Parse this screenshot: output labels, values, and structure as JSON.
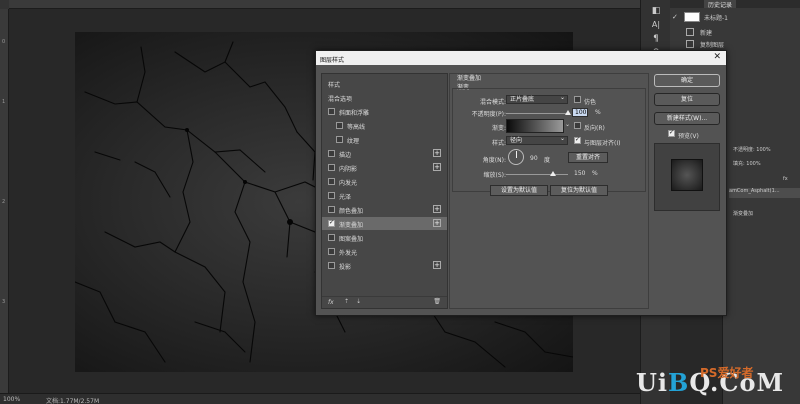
{
  "statusbar": {
    "zoom": "100%",
    "doc_info": "文档:1.77M/2.57M"
  },
  "rulers": {
    "left_ticks": [
      "0",
      "1",
      "2",
      "3"
    ]
  },
  "panels": {
    "top_tab": "历史记录",
    "history_items": [
      {
        "label": "未标题-1"
      },
      {
        "label": "新建"
      },
      {
        "label": "复制图层"
      }
    ],
    "layers_rows": [
      "不透明度: 100%",
      "填充: 100%",
      "fx",
      "amCom_Asphalt(1...",
      "渐变叠加"
    ]
  },
  "dialog": {
    "title": "图层样式",
    "close": "✕",
    "style_list": [
      {
        "label": "样式",
        "checkbox": false,
        "checked": false,
        "plus": false,
        "selected": false,
        "indent": 0
      },
      {
        "label": "混合选项",
        "checkbox": false,
        "checked": false,
        "plus": false,
        "selected": false,
        "indent": 0
      },
      {
        "label": "斜面和浮雕",
        "checkbox": true,
        "checked": false,
        "plus": false,
        "selected": false,
        "indent": 0
      },
      {
        "label": "等高线",
        "checkbox": true,
        "checked": false,
        "plus": false,
        "selected": false,
        "indent": 1
      },
      {
        "label": "纹理",
        "checkbox": true,
        "checked": false,
        "plus": false,
        "selected": false,
        "indent": 1
      },
      {
        "label": "描边",
        "checkbox": true,
        "checked": false,
        "plus": true,
        "selected": false,
        "indent": 0
      },
      {
        "label": "内阴影",
        "checkbox": true,
        "checked": false,
        "plus": true,
        "selected": false,
        "indent": 0
      },
      {
        "label": "内发光",
        "checkbox": true,
        "checked": false,
        "plus": false,
        "selected": false,
        "indent": 0
      },
      {
        "label": "光泽",
        "checkbox": true,
        "checked": false,
        "plus": false,
        "selected": false,
        "indent": 0
      },
      {
        "label": "颜色叠加",
        "checkbox": true,
        "checked": false,
        "plus": true,
        "selected": false,
        "indent": 0
      },
      {
        "label": "渐变叠加",
        "checkbox": true,
        "checked": true,
        "plus": true,
        "selected": true,
        "indent": 0
      },
      {
        "label": "图案叠加",
        "checkbox": true,
        "checked": false,
        "plus": false,
        "selected": false,
        "indent": 0
      },
      {
        "label": "外发光",
        "checkbox": true,
        "checked": false,
        "plus": false,
        "selected": false,
        "indent": 0
      },
      {
        "label": "投影",
        "checkbox": true,
        "checked": false,
        "plus": true,
        "selected": false,
        "indent": 0
      }
    ],
    "style_list_footer": {
      "fx": "fx",
      "up": "⇡",
      "down": "⇣",
      "trash": "🗑"
    },
    "section_title": "渐变叠加",
    "subsection_title": "渐变",
    "blend_mode_label": "混合模式:",
    "blend_mode_value": "正片叠底",
    "dither_label": "仿色",
    "dither_checked": false,
    "opacity_label": "不透明度(P):",
    "opacity_value": "100",
    "opacity_unit": "%",
    "opacity_fraction": 1.0,
    "gradient_label": "渐变:",
    "reverse_label": "反向(R)",
    "reverse_checked": false,
    "style_label": "样式:",
    "style_value": "径向",
    "align_label": "与图层对齐(I)",
    "align_checked": true,
    "angle_label": "角度(N):",
    "angle_value": "90",
    "angle_unit": "度",
    "reset_align_button": "重置对齐",
    "scale_label": "缩放(S):",
    "scale_value": "150",
    "scale_unit": "%",
    "scale_fraction": 0.75,
    "set_default_button": "设置为默认值",
    "reset_default_button": "复位为默认值",
    "ok_button": "确定",
    "cancel_button": "复位",
    "new_style_button": "新建样式(W)...",
    "preview_label": "预览(V)",
    "preview_checked": true
  },
  "watermark": {
    "brand_pre": "Ui",
    "brand_q": "B",
    "brand_post": "Q.CoM",
    "brand_cn": "PS爱好者"
  },
  "colors": {
    "dialog_bg": "#535353",
    "highlight": "#c9d9f0",
    "watermark_accent": "#23a2d6"
  }
}
